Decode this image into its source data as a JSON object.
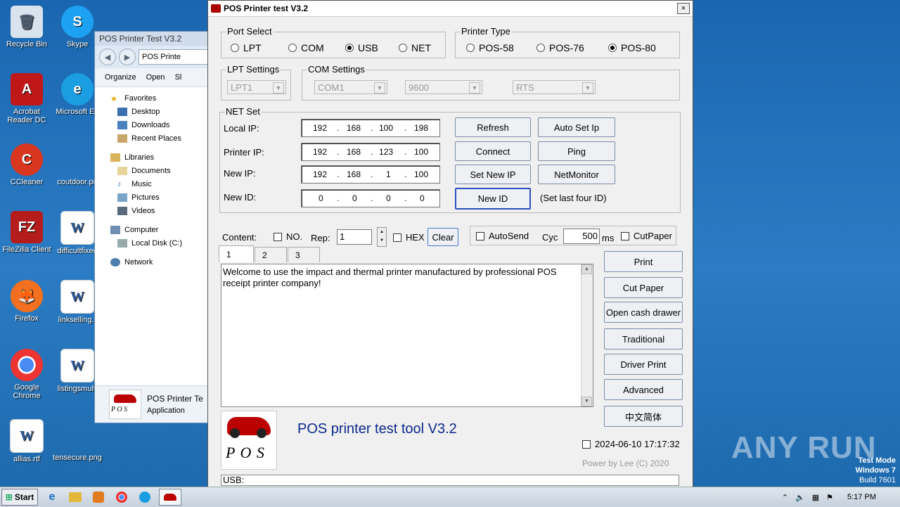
{
  "desktop_icons": [
    {
      "label": "Recycle Bin"
    },
    {
      "label": "Skype"
    },
    {
      "label": "Acrobat Reader DC"
    },
    {
      "label": "Microsoft Ed"
    },
    {
      "label": "CCleaner"
    },
    {
      "label": "coutdoor.pn"
    },
    {
      "label": "FileZilla Client"
    },
    {
      "label": "difficultfixed"
    },
    {
      "label": "Firefox"
    },
    {
      "label": "linkselling.r"
    },
    {
      "label": "Google Chrome"
    },
    {
      "label": "listingsmulti"
    },
    {
      "label": "allias.rtf"
    },
    {
      "label": "tensecure.png"
    }
  ],
  "explorer": {
    "title": "POS Printer Test V3.2",
    "address": "POS Printe",
    "toolbar": {
      "organize": "Organize",
      "open": "Open",
      "share": "Sl"
    },
    "tree": [
      "Favorites",
      "Desktop",
      "Downloads",
      "Recent Places",
      "Libraries",
      "Documents",
      "Music",
      "Pictures",
      "Videos",
      "Computer",
      "Local Disk (C:)",
      "Network"
    ],
    "detail": {
      "name": "POS Printer Te",
      "type": "Application"
    }
  },
  "pos": {
    "title": "POS Printer test V3.2",
    "close": "×",
    "port_select": {
      "legend": "Port Select",
      "options": [
        "LPT",
        "COM",
        "USB",
        "NET"
      ],
      "selected": "USB"
    },
    "printer_type": {
      "legend": "Printer Type",
      "options": [
        "POS-58",
        "POS-76",
        "POS-80"
      ],
      "selected": "POS-80"
    },
    "lpt_settings": {
      "legend": "LPT Settings",
      "port": "LPT1"
    },
    "com_settings": {
      "legend": "COM Settings",
      "port": "COM1",
      "baud": "9600",
      "flow": "RTS"
    },
    "net_set": {
      "legend": "NET Set",
      "local_ip_label": "Local IP:",
      "local_ip": [
        "192",
        "168",
        "100",
        "198"
      ],
      "printer_ip_label": "Printer IP:",
      "printer_ip": [
        "192",
        "168",
        "123",
        "100"
      ],
      "new_ip_label": "New IP:",
      "new_ip": [
        "192",
        "168",
        "1",
        "100"
      ],
      "new_id_label": "New ID:",
      "new_id": [
        "0",
        "0",
        "0",
        "0"
      ],
      "buttons": {
        "refresh": "Refresh",
        "auto_set_ip": "Auto Set Ip",
        "connect": "Connect",
        "ping": "Ping",
        "set_new_ip": "Set New IP",
        "netmonitor": "NetMonitor",
        "new_id": "New ID"
      },
      "hint": "(Set last four ID)"
    },
    "content_row": {
      "content": "Content:",
      "no": "NO.",
      "rep": "Rep:",
      "rep_value": "1",
      "hex": "HEX",
      "clear": "Clear",
      "autosend": "AutoSend",
      "cyc": "Cyc",
      "cyc_value": "500",
      "ms": "ms",
      "cutpaper": "CutPaper"
    },
    "tabs": [
      "1",
      "2",
      "3"
    ],
    "text": "Welcome to use the impact and thermal printer manufactured by professional POS receipt printer company!",
    "side_buttons": [
      "Print",
      "Cut Paper",
      "Open cash drawer",
      "Traditional",
      "Driver Print",
      "Advanced",
      "中文简体"
    ],
    "footer": {
      "tool_title": "POS printer test tool V3.2",
      "datetime": "2024-06-10 17:17:32",
      "power": "Power by Lee (C) 2020",
      "logo_text": "P O S"
    },
    "status": "USB:"
  },
  "taskbar": {
    "start": "Start",
    "time": "5:17 PM"
  },
  "watermark": "ANY RUN",
  "testmode": {
    "line1": "Test Mode",
    "line2": "Windows 7",
    "line3": "Build 7601"
  }
}
